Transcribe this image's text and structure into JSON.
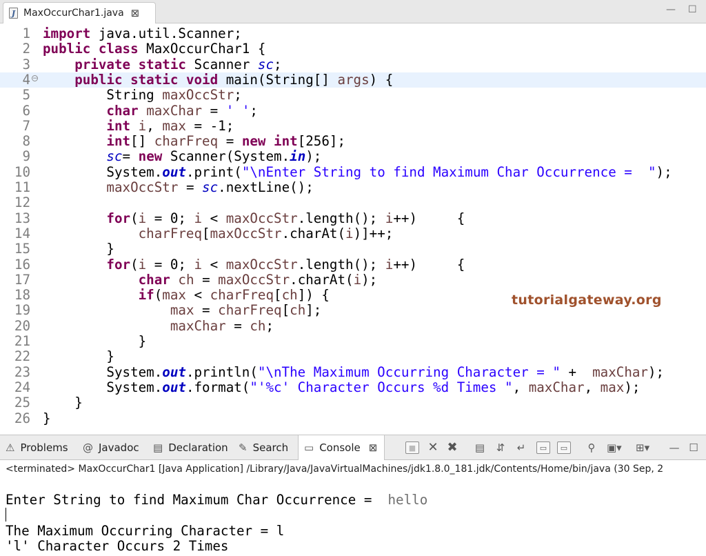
{
  "editor_tab": {
    "filename": "MaxOccurChar1.java",
    "close_glyph": "⊠"
  },
  "window_controls": {
    "minimize": "—",
    "maximize": "☐"
  },
  "code_lines": [
    {
      "n": "1",
      "html": "<span class=\"kw\">import</span> java.util.Scanner;"
    },
    {
      "n": "2",
      "html": "<span class=\"kw\">public class</span> MaxOccurChar1 {"
    },
    {
      "n": "3",
      "html": "    <span class=\"kw\">private static</span> Scanner <span class=\"sfld\" style=\"font-weight:normal\">sc</span>;"
    },
    {
      "n": "4",
      "html": "    <span class=\"kw\">public static void</span> main(String[] <span class=\"var\">args</span>) {",
      "fold": true
    },
    {
      "n": "5",
      "html": "        String <span class=\"var\">maxOccStr</span>;"
    },
    {
      "n": "6",
      "html": "        <span class=\"kw\">char</span> <span class=\"var\">maxChar</span> = <span class=\"str\">' '</span>;"
    },
    {
      "n": "7",
      "html": "        <span class=\"kw\">int</span> <span class=\"var\">i</span>, <span class=\"var\">max</span> = -1;"
    },
    {
      "n": "8",
      "html": "        <span class=\"kw\">int</span>[] <span class=\"var\">charFreq</span> = <span class=\"kw\">new int</span>[256];"
    },
    {
      "n": "9",
      "html": "        <span class=\"fld\">sc</span>= <span class=\"kw\">new</span> Scanner(System.<span class=\"sfld\">in</span>);"
    },
    {
      "n": "10",
      "html": "        System.<span class=\"sfld\">out</span>.print(<span class=\"str\">\"\\nEnter String to find Maximum Char Occurrence =  \"</span>);"
    },
    {
      "n": "11",
      "html": "        <span class=\"var\">maxOccStr</span> = <span class=\"fld\">sc</span>.nextLine();"
    },
    {
      "n": "12",
      "html": ""
    },
    {
      "n": "13",
      "html": "        <span class=\"kw\">for</span>(<span class=\"var\">i</span> = 0; <span class=\"var\">i</span> &lt; <span class=\"var\">maxOccStr</span>.length(); <span class=\"var\">i</span>++)     {"
    },
    {
      "n": "14",
      "html": "            <span class=\"var\">charFreq</span>[<span class=\"var\">maxOccStr</span>.charAt(<span class=\"var\">i</span>)]++;"
    },
    {
      "n": "15",
      "html": "        }"
    },
    {
      "n": "16",
      "html": "        <span class=\"kw\">for</span>(<span class=\"var\">i</span> = 0; <span class=\"var\">i</span> &lt; <span class=\"var\">maxOccStr</span>.length(); <span class=\"var\">i</span>++)     {"
    },
    {
      "n": "17",
      "html": "            <span class=\"kw\">char</span> <span class=\"var\">ch</span> = <span class=\"var\">maxOccStr</span>.charAt(<span class=\"var\">i</span>);"
    },
    {
      "n": "18",
      "html": "            <span class=\"kw\">if</span>(<span class=\"var\">max</span> &lt; <span class=\"var\">charFreq</span>[<span class=\"var\">ch</span>]) {"
    },
    {
      "n": "19",
      "html": "                <span class=\"var\">max</span> = <span class=\"var\">charFreq</span>[<span class=\"var\">ch</span>];"
    },
    {
      "n": "20",
      "html": "                <span class=\"var\">maxChar</span> = <span class=\"var\">ch</span>;"
    },
    {
      "n": "21",
      "html": "            }"
    },
    {
      "n": "22",
      "html": "        }"
    },
    {
      "n": "23",
      "html": "        System.<span class=\"sfld\">out</span>.println(<span class=\"str\">\"\\nThe Maximum Occurring Character = \"</span> +  <span class=\"var\">maxChar</span>);"
    },
    {
      "n": "24",
      "html": "        System.<span class=\"sfld\">out</span>.format(<span class=\"str\">\"'%c' Character Occurs %d Times \"</span>, <span class=\"var\">maxChar</span>, <span class=\"var\">max</span>);"
    },
    {
      "n": "25",
      "html": "    }"
    },
    {
      "n": "26",
      "html": "}"
    }
  ],
  "watermark": "tutorialgateway.org",
  "views": {
    "problems": "Problems",
    "javadoc": "Javadoc",
    "declaration": "Declaration",
    "search": "Search",
    "console": "Console"
  },
  "console": {
    "status": "<terminated> MaxOccurChar1 [Java Application] /Library/Java/JavaVirtualMachines/jdk1.8.0_181.jdk/Contents/Home/bin/java  (30 Sep, 2",
    "prompt": "Enter String to find Maximum Char Occurrence =  ",
    "user_input": "hello",
    "result_line": "The Maximum Occurring Character = l",
    "count_line": "'l' Character Occurs 2 Times"
  }
}
